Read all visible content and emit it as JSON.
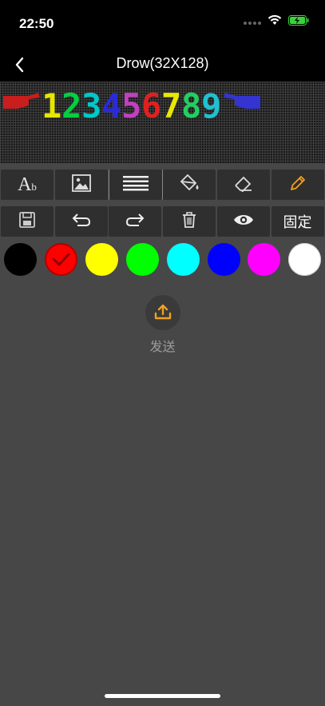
{
  "status": {
    "time": "22:50"
  },
  "nav": {
    "title": "Drow(32X128)"
  },
  "led": {
    "digits": [
      "1",
      "2",
      "3",
      "4",
      "5",
      "6",
      "7",
      "8",
      "9"
    ],
    "digit_colors": [
      "#e6e600",
      "#00d040",
      "#00c8c8",
      "#2a2ad8",
      "#c040c0",
      "#e02020",
      "#e8e800",
      "#20d060",
      "#20c0d0"
    ],
    "hand_left_color": "#c81e1e",
    "hand_right_color": "#3434d0"
  },
  "toolbar1": [
    {
      "name": "text-tool-button",
      "icon": "text-icon",
      "glyph": "A",
      "sub": "b",
      "active": false
    },
    {
      "name": "image-tool-button",
      "icon": "image-icon",
      "active": false
    },
    {
      "name": "lines-tool-button",
      "icon": "lines-icon",
      "active": true
    },
    {
      "name": "fill-tool-button",
      "icon": "paint-bucket-icon",
      "active": false
    },
    {
      "name": "eraser-tool-button",
      "icon": "eraser-icon",
      "active": false
    },
    {
      "name": "pencil-tool-button",
      "icon": "pencil-icon",
      "active": false,
      "color": "#f0a020"
    }
  ],
  "toolbar2": [
    {
      "name": "save-button",
      "icon": "save-icon"
    },
    {
      "name": "undo-button",
      "icon": "undo-icon"
    },
    {
      "name": "redo-button",
      "icon": "redo-icon"
    },
    {
      "name": "delete-button",
      "icon": "trash-icon"
    },
    {
      "name": "preview-button",
      "icon": "eye-icon"
    },
    {
      "name": "fixed-button",
      "label": "固定"
    }
  ],
  "colors": [
    {
      "hex": "#000000",
      "selected": false
    },
    {
      "hex": "#ff0000",
      "selected": true
    },
    {
      "hex": "#ffff00",
      "selected": false
    },
    {
      "hex": "#00ff00",
      "selected": false
    },
    {
      "hex": "#00ffff",
      "selected": false
    },
    {
      "hex": "#0000ff",
      "selected": false
    },
    {
      "hex": "#ff00ff",
      "selected": false
    },
    {
      "hex": "#ffffff",
      "selected": false
    }
  ],
  "send": {
    "label": "发送",
    "icon_color": "#f0a020"
  }
}
